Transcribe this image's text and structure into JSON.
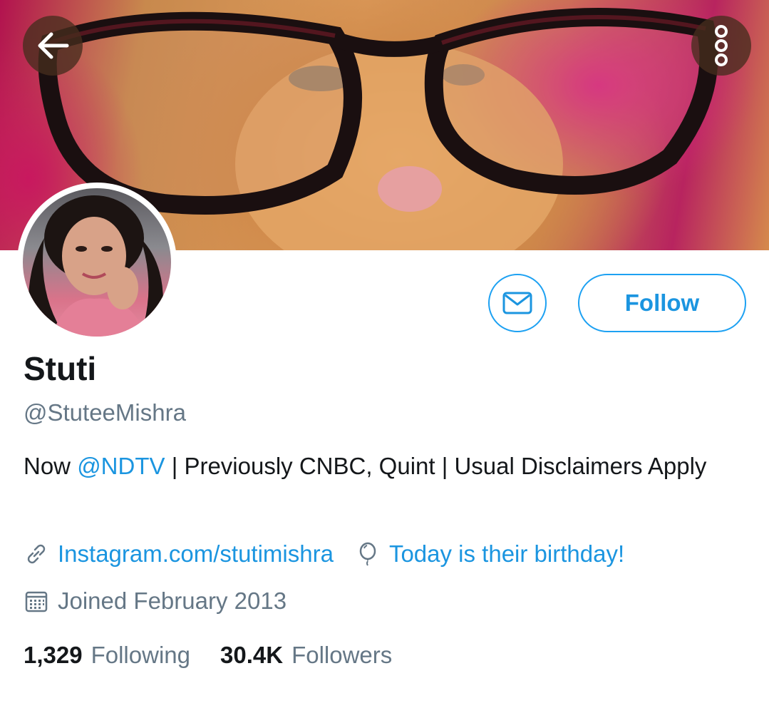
{
  "header": {
    "back_icon": "arrow-left-icon",
    "more_icon": "vertical-dots-icon"
  },
  "profile": {
    "name": "Stuti",
    "handle": "@StuteeMishra",
    "bio_prefix": "Now ",
    "bio_mention": "@NDTV",
    "bio_rest": " | Previously CNBC, Quint | Usual Disclaimers Apply",
    "website": "Instagram.com/stutimishra",
    "birthday": "Today is their birthday!",
    "joined": "Joined February 2013"
  },
  "actions": {
    "message_icon": "envelope-icon",
    "follow_label": "Follow"
  },
  "stats": {
    "following_count": "1,329",
    "following_label": "Following",
    "followers_count": "30.4K",
    "followers_label": "Followers"
  },
  "colors": {
    "accent": "#1da1f2",
    "link": "#1b95e0",
    "muted": "#657786",
    "text": "#14171a"
  }
}
